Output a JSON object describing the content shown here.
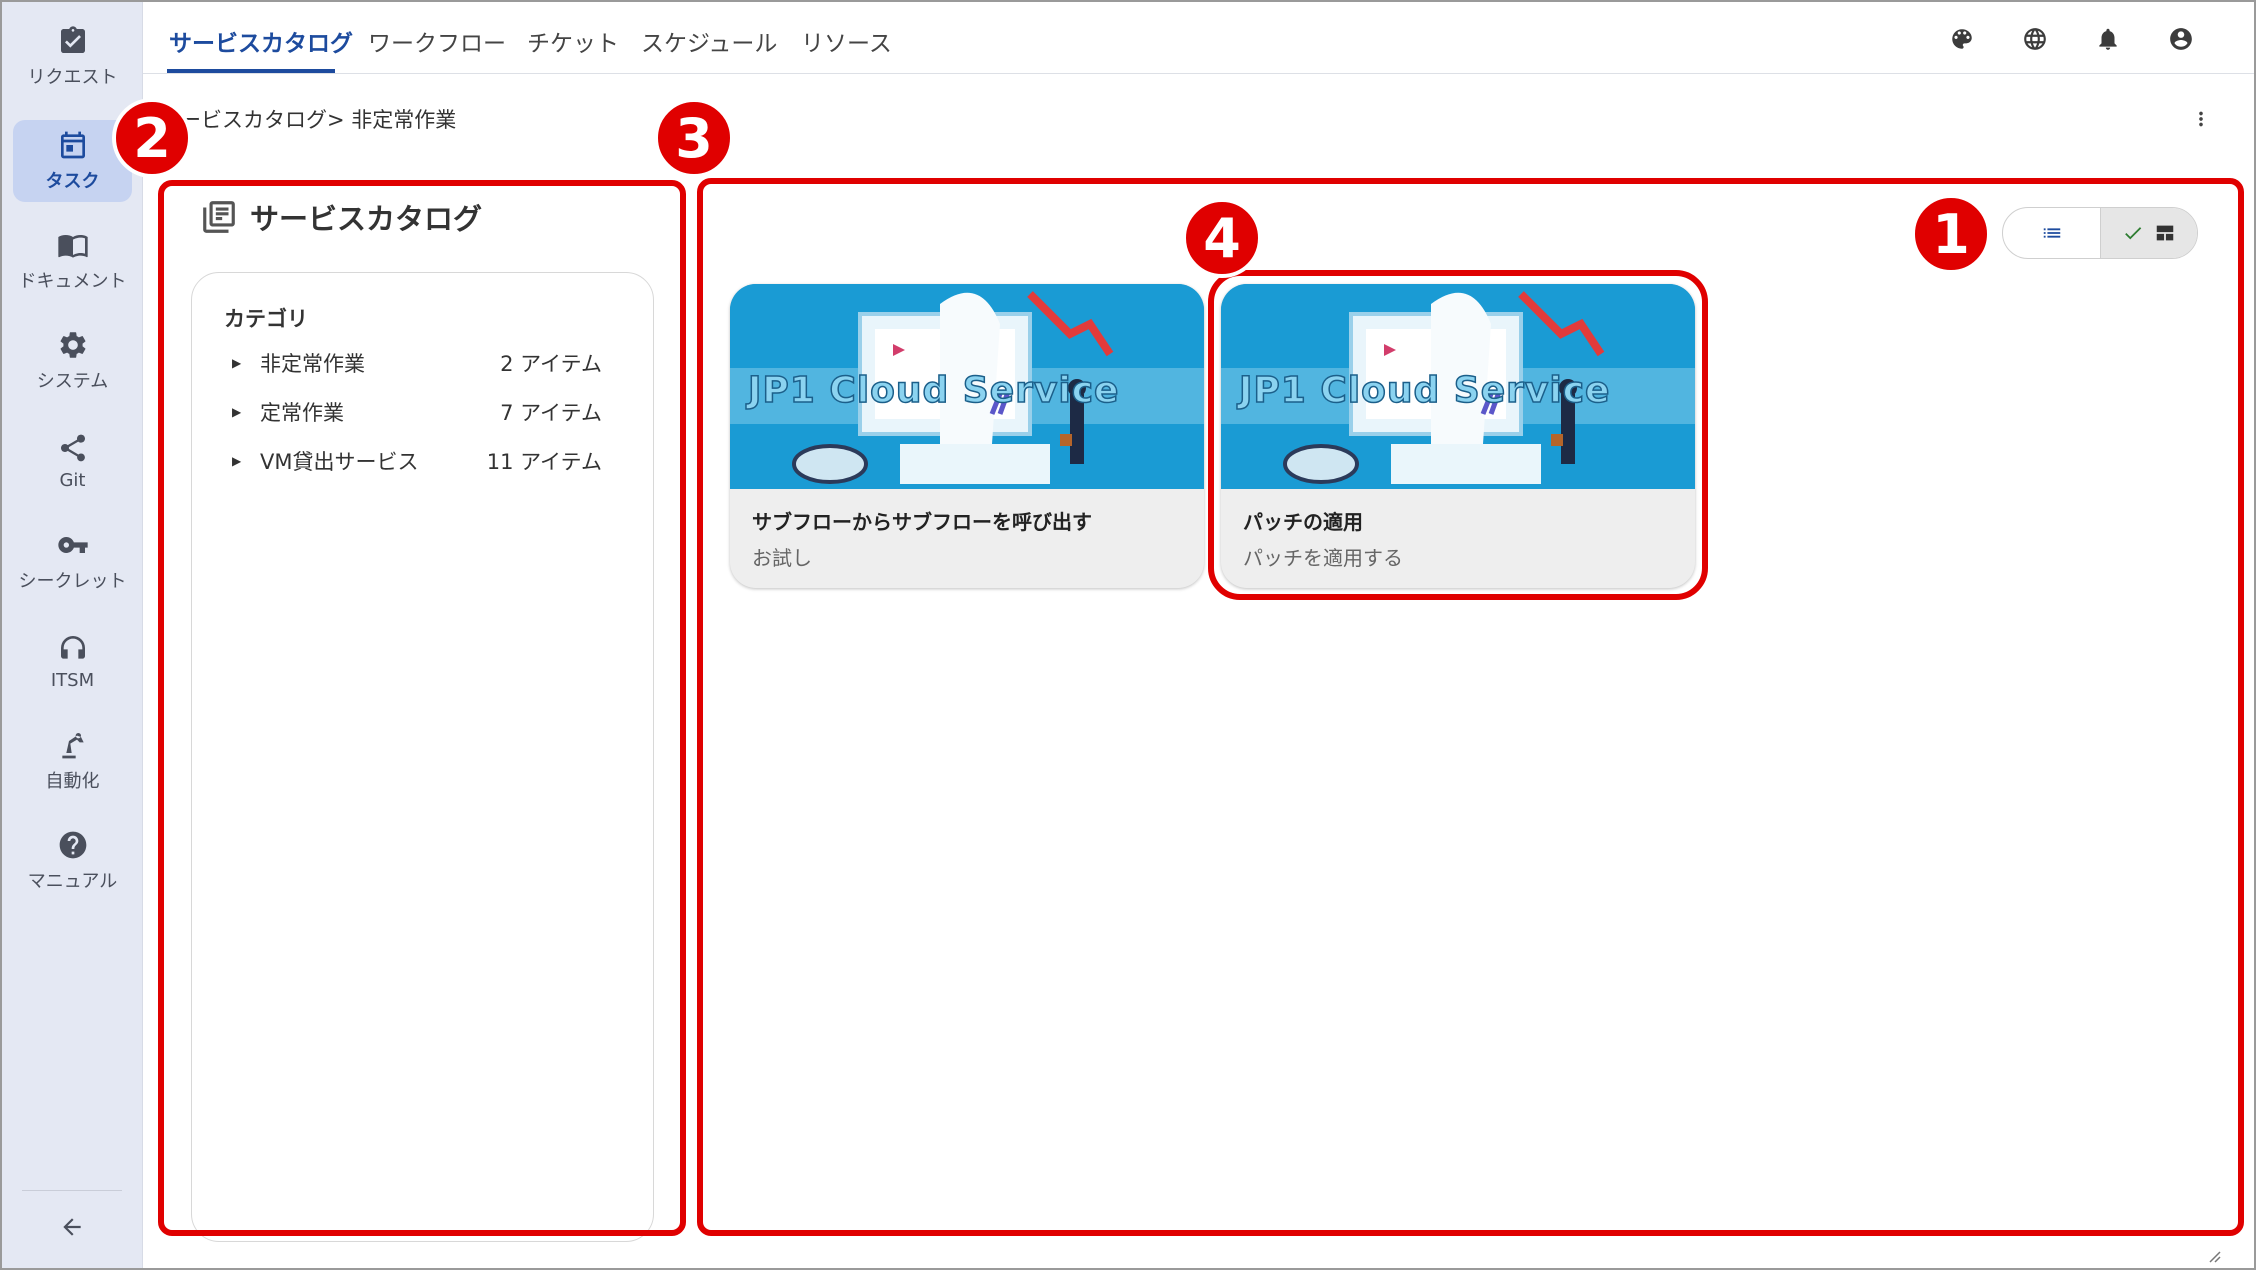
{
  "rail": {
    "items": [
      {
        "label": "リクエスト",
        "icon": "clipboard-check-icon"
      },
      {
        "label": "タスク",
        "icon": "calendar-icon",
        "active": true
      },
      {
        "label": "ドキュメント",
        "icon": "book-icon"
      },
      {
        "label": "システム",
        "icon": "gear-icon"
      },
      {
        "label": "Git",
        "icon": "share-icon"
      },
      {
        "label": "シークレット",
        "icon": "key-icon"
      },
      {
        "label": "ITSM",
        "icon": "headset-icon"
      },
      {
        "label": "自動化",
        "icon": "robot-arm-icon"
      },
      {
        "label": "マニュアル",
        "icon": "help-icon"
      }
    ],
    "collapse_icon": "arrow-left-icon"
  },
  "topbar": {
    "tabs": [
      {
        "label": "サービスカタログ",
        "active": true
      },
      {
        "label": "ワークフロー"
      },
      {
        "label": "チケット"
      },
      {
        "label": "スケジュール"
      },
      {
        "label": "リソース"
      }
    ],
    "icons": [
      "palette-icon",
      "globe-icon",
      "bell-icon",
      "account-icon"
    ]
  },
  "breadcrumb": "ービスカタログ> 非定常作業",
  "sidebar": {
    "title": "サービスカタログ",
    "category_heading": "カテゴリ",
    "categories": [
      {
        "name": "非定常作業",
        "count": "2 アイテム"
      },
      {
        "name": "定常作業",
        "count": "7 アイテム"
      },
      {
        "name": "VM貸出サービス",
        "count": "11 アイテム"
      }
    ]
  },
  "main": {
    "view_toggle": {
      "options": [
        "list",
        "card"
      ],
      "selected": "card"
    },
    "cards": [
      {
        "banner_text": "JP1 Cloud Service",
        "title": "サブフローからサブフローを呼び出す",
        "description": "お試し"
      },
      {
        "banner_text": "JP1 Cloud Service",
        "title": "パッチの適用",
        "description": "パッチを適用する"
      }
    ]
  },
  "annotations": {
    "badges": [
      "1",
      "2",
      "3",
      "4"
    ],
    "color": "#e00000"
  },
  "colors": {
    "accent": "#1d4b9e",
    "rail_bg": "#e4e8f3",
    "rail_active": "#c6d3f1",
    "banner": "#1a9bd4"
  }
}
